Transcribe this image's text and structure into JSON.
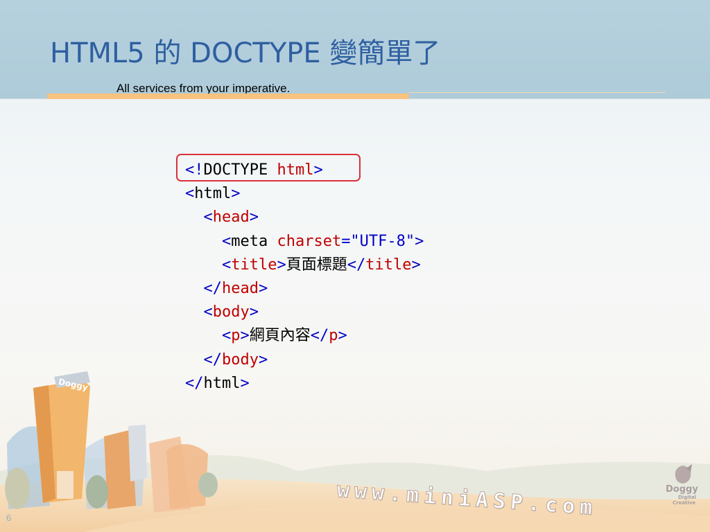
{
  "slide": {
    "title": "HTML5 的 DOCTYPE 變簡單了",
    "subtitle": "All services from your imperative.",
    "page_number": "6"
  },
  "code_lines": [
    [
      {
        "t": "<!",
        "c": "b"
      },
      {
        "t": "DOCTYPE ",
        "c": "k"
      },
      {
        "t": "html",
        "c": "r"
      },
      {
        "t": ">",
        "c": "b"
      }
    ],
    [
      {
        "t": "<",
        "c": "b"
      },
      {
        "t": "html",
        "c": "k"
      },
      {
        "t": ">",
        "c": "b"
      }
    ],
    [
      {
        "t": "  <",
        "c": "b"
      },
      {
        "t": "head",
        "c": "r"
      },
      {
        "t": ">",
        "c": "b"
      }
    ],
    [
      {
        "t": "    <",
        "c": "b"
      },
      {
        "t": "meta ",
        "c": "k"
      },
      {
        "t": "charset",
        "c": "r"
      },
      {
        "t": "=\"UTF-8\">",
        "c": "b"
      }
    ],
    [
      {
        "t": "    <",
        "c": "b"
      },
      {
        "t": "title",
        "c": "r"
      },
      {
        "t": ">",
        "c": "b"
      },
      {
        "t": "頁面標題",
        "c": "k"
      },
      {
        "t": "</",
        "c": "b"
      },
      {
        "t": "title",
        "c": "r"
      },
      {
        "t": ">",
        "c": "b"
      }
    ],
    [
      {
        "t": "  </",
        "c": "b"
      },
      {
        "t": "head",
        "c": "r"
      },
      {
        "t": ">",
        "c": "b"
      }
    ],
    [
      {
        "t": "  <",
        "c": "b"
      },
      {
        "t": "body",
        "c": "r"
      },
      {
        "t": ">",
        "c": "b"
      }
    ],
    [
      {
        "t": "    <",
        "c": "b"
      },
      {
        "t": "p",
        "c": "r"
      },
      {
        "t": ">",
        "c": "b"
      },
      {
        "t": "網頁內容",
        "c": "k"
      },
      {
        "t": "</",
        "c": "b"
      },
      {
        "t": "p",
        "c": "r"
      },
      {
        "t": ">",
        "c": "b"
      }
    ],
    [
      {
        "t": "  </",
        "c": "b"
      },
      {
        "t": "body",
        "c": "r"
      },
      {
        "t": ">",
        "c": "b"
      }
    ],
    [
      {
        "t": "</",
        "c": "b"
      },
      {
        "t": "html",
        "c": "k"
      },
      {
        "t": ">",
        "c": "b"
      }
    ]
  ],
  "decoration": {
    "website": "www.miniASP.com",
    "building_sign": "Doggy",
    "logo_name": "Doggy",
    "logo_tagline_1": "Digital",
    "logo_tagline_2": "Creative"
  },
  "colors": {
    "title": "#2e5fa0",
    "tag_blue": "#0000c8",
    "tag_red": "#c00000",
    "highlight_border": "#d9303a",
    "header_band": "#b1cedb",
    "accent_orange": "#f8c27f"
  }
}
